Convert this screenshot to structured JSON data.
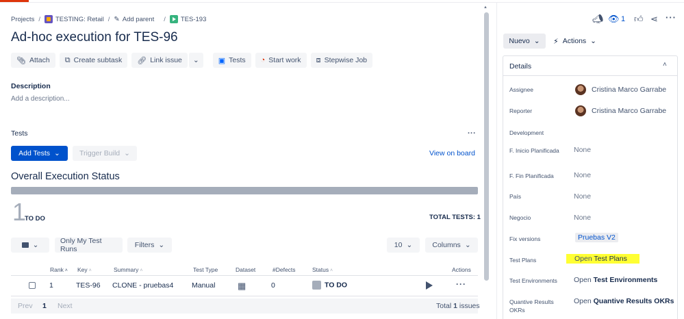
{
  "breadcrumb": {
    "projects": "Projects",
    "project": "TESTING: Retail",
    "add_parent": "Add parent",
    "issue_key": "TES-193"
  },
  "issue": {
    "title": "Ad-hoc execution for TES-96"
  },
  "toolbar": {
    "attach": "Attach",
    "create_subtask": "Create subtask",
    "link_issue": "Link issue",
    "tests": "Tests",
    "start_work": "Start work",
    "stepwise_job": "Stepwise Job"
  },
  "description": {
    "label": "Description",
    "placeholder": "Add a description..."
  },
  "tests_panel": {
    "label": "Tests",
    "more": "...",
    "add_tests": "Add Tests",
    "trigger_build": "Trigger Build",
    "view_on_board": "View on board",
    "overall_title": "Overall Execution Status",
    "todo_count": "1",
    "todo_label": "TO DO",
    "total_tests": "TOTAL TESTS: 1",
    "only_my_runs": "Only My Test Runs",
    "filters": "Filters",
    "page_size": "10",
    "columns": "Columns",
    "headers": [
      "Rank",
      "Key",
      "Summary",
      "Test Type",
      "Dataset",
      "#Defects",
      "Status",
      "Actions"
    ],
    "row": {
      "rank": "1",
      "key": "TES-96",
      "summary": "CLONE - pruebas4",
      "test_type": "Manual",
      "defects": "0",
      "status": "TO DO"
    },
    "pager": {
      "prev": "Prev",
      "page": "1",
      "next": "Next",
      "total_prefix": "Total",
      "total_count": "1",
      "total_suffix": "issues"
    }
  },
  "right_panel": {
    "watch_count": "1",
    "status_button": "Nuevo",
    "actions": "Actions",
    "details_title": "Details",
    "fields": {
      "assignee_label": "Assignee",
      "assignee_value": "Cristina Marco Garrabe",
      "reporter_label": "Reporter",
      "reporter_value": "Cristina Marco Garrabe",
      "development_label": "Development",
      "inicio_label": "F. Inicio Planificada",
      "inicio_value": "None",
      "fin_label": "F. Fin Planificada",
      "fin_value": "None",
      "pais_label": "País",
      "pais_value": "None",
      "negocio_label": "Negocio",
      "negocio_value": "None",
      "fix_label": "Fix versions",
      "fix_value": "Pruebas V2",
      "plans_label": "Test Plans",
      "plans_open": "Open",
      "plans_value": "Test Plans",
      "env_label": "Test Environments",
      "env_open": "Open",
      "env_value": "Test Environments",
      "okr_label_1": "Quantive Results",
      "okr_label_2": "OKRs",
      "okr_open": "Open",
      "okr_value": "Quantive Results OKRs"
    }
  },
  "colors": {
    "primary": "#0052cc",
    "highlight": "#ffff33",
    "todo_grey": "#a5adba"
  }
}
